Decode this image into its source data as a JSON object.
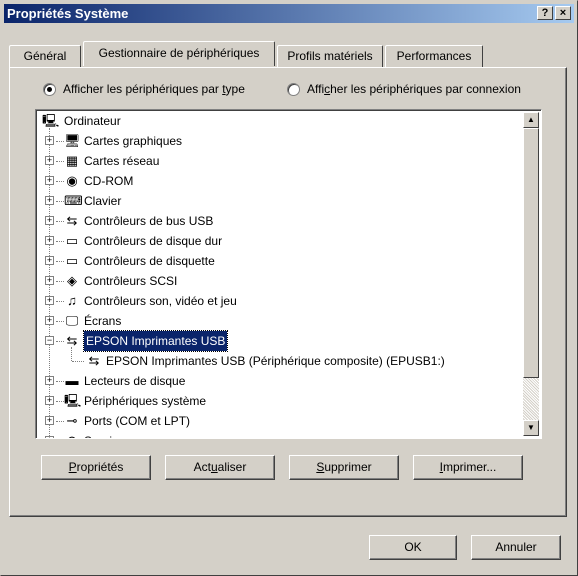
{
  "window": {
    "title": "Propriétés Système",
    "help_button": "?",
    "close_button": "×"
  },
  "tabs": [
    {
      "label": "Général"
    },
    {
      "label": "Gestionnaire de périphériques"
    },
    {
      "label": "Profils matériels"
    },
    {
      "label": "Performances"
    }
  ],
  "radios": [
    {
      "pre": "Afficher les périphériques par ",
      "mn": "t",
      "post": "ype",
      "checked": true
    },
    {
      "pre": "Affi",
      "mn": "c",
      "post": "her les périphériques par connexion",
      "checked": false
    }
  ],
  "tree": {
    "root": "Ordinateur",
    "items": [
      {
        "label": "Cartes graphiques",
        "icon": "monitor-icon",
        "glyph": "🖥"
      },
      {
        "label": "Cartes réseau",
        "icon": "network-card-icon",
        "glyph": "▦"
      },
      {
        "label": "CD-ROM",
        "icon": "cdrom-icon",
        "glyph": "◉"
      },
      {
        "label": "Clavier",
        "icon": "keyboard-icon",
        "glyph": "⌨"
      },
      {
        "label": "Contrôleurs de bus USB",
        "icon": "usb-icon",
        "glyph": "⇆"
      },
      {
        "label": "Contrôleurs de disque dur",
        "icon": "hard-disk-icon",
        "glyph": "▭"
      },
      {
        "label": "Contrôleurs de disquette",
        "icon": "floppy-controller-icon",
        "glyph": "▭"
      },
      {
        "label": "Contrôleurs SCSI",
        "icon": "scsi-icon",
        "glyph": "◈"
      },
      {
        "label": "Contrôleurs son, vidéo et jeu",
        "icon": "sound-icon",
        "glyph": "♫"
      },
      {
        "label": "Écrans",
        "icon": "display-icon",
        "glyph": "🖵"
      },
      {
        "label": "EPSON Imprimantes USB",
        "icon": "usb-printer-icon",
        "glyph": "⇆",
        "expanded": true,
        "selected": true
      },
      {
        "label": "Lecteurs de disque",
        "icon": "disk-drive-icon",
        "glyph": "▬"
      },
      {
        "label": "Périphériques système",
        "icon": "system-device-icon",
        "glyph": "🖳"
      },
      {
        "label": "Ports (COM et LPT)",
        "icon": "port-icon",
        "glyph": "⊸"
      },
      {
        "label": "Souris",
        "icon": "mouse-icon",
        "glyph": "⊙"
      }
    ],
    "child": {
      "label": "EPSON Imprimantes USB (Périphérique composite) (EPUSB1:)",
      "icon": "usb-composite-icon",
      "glyph": "⇆"
    }
  },
  "buttons": {
    "properties": {
      "mn": "P",
      "post": "ropriétés"
    },
    "refresh": {
      "pre": "Act",
      "mn": "u",
      "post": "aliser"
    },
    "remove": {
      "mn": "S",
      "post": "upprimer"
    },
    "print": {
      "mn": "I",
      "post": "mprimer..."
    }
  },
  "footer": {
    "ok": "OK",
    "cancel": "Annuler"
  }
}
